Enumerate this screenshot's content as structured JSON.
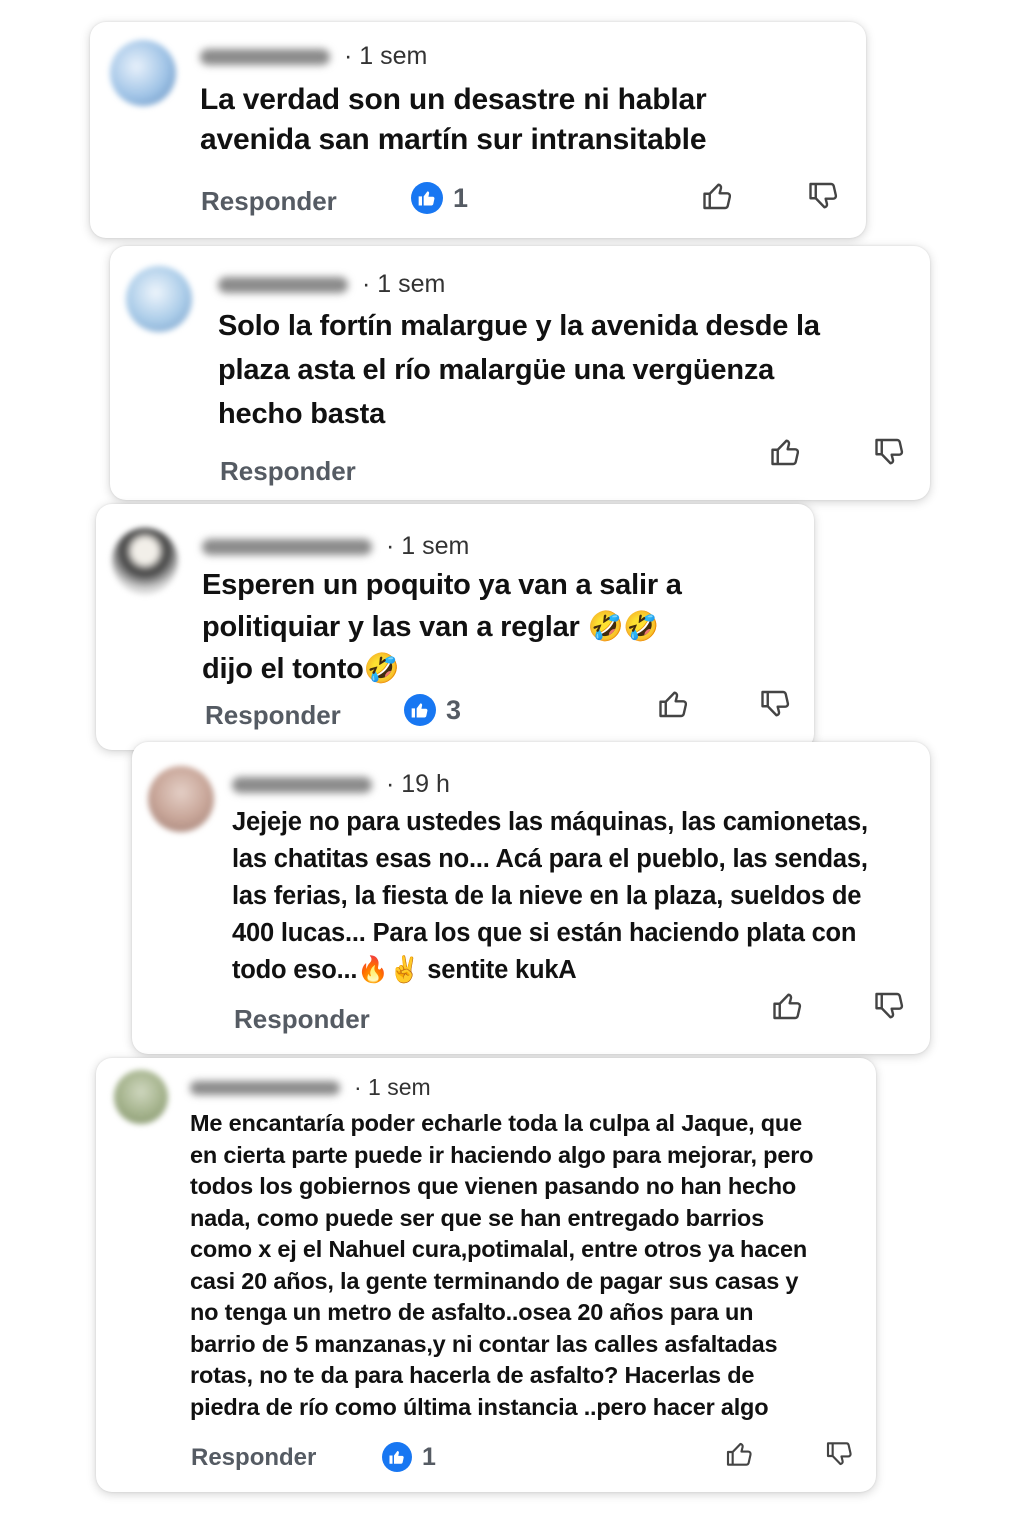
{
  "comments": [
    {
      "time": "· 1 sem",
      "text": "La verdad son un desastre ni hablar\navenida san martín sur intransitable",
      "reply_label": "Responder",
      "like_count": "1",
      "avatar_colors": [
        "#9fc3e6",
        "#e8f1fb",
        "#5a86b8"
      ]
    },
    {
      "time": "· 1 sem",
      "text": "Solo la fortín malargue y la avenida desde la\nplaza asta el río malargüe una vergüenza\nhecho basta",
      "reply_label": "Responder",
      "like_count": "",
      "avatar_colors": [
        "#a9cbe8",
        "#eef5fc",
        "#6d95c2"
      ]
    },
    {
      "time": "· 1 sem",
      "text": "Esperen un poquito ya van a salir a\npolitiquiar y las van a reglar 🤣🤣\ndijo el tonto🤣",
      "reply_label": "Responder",
      "like_count": "3",
      "avatar_colors": [
        "#d9d9d9",
        "#3a3a3a",
        "#f2efe9"
      ]
    },
    {
      "time": "· 19 h",
      "text": "Jejeje no para ustedes las máquinas, las camionetas,\nlas chatitas esas no... Acá para el pueblo, las sendas,\nlas ferias, la fiesta de la nieve en la plaza, sueldos de\n400 lucas... Para los que si están haciendo plata con\ntodo eso...🔥✌️ sentite kukA",
      "reply_label": "Responder",
      "like_count": "",
      "avatar_colors": [
        "#c9a79a",
        "#9c7a70",
        "#e4cfc6"
      ]
    },
    {
      "time": "· 1 sem",
      "text": "Me encantaría poder echarle toda la culpa al Jaque, que\nen cierta parte puede ir haciendo algo para mejorar, pero\ntodos los gobiernos que vienen pasando no han hecho\nnada, como puede ser que se han entregado barrios\ncomo x ej el Nahuel cura,potimalal, entre otros ya hacen\ncasi 20 años, la gente terminando de pagar sus casas y\nno tenga un metro de asfalto..osea 20 años para un\nbarrio de 5 manzanas,y ni contar las calles asfaltadas\nrotas, no te da para hacerla de asfalto? Hacerlas  de\npiedra de río como última instancia ..pero hacer algo",
      "reply_label": "Responder",
      "like_count": "1",
      "avatar_colors": [
        "#a7b58f",
        "#7e8f67",
        "#cfd7bf"
      ]
    }
  ],
  "icons": {
    "like_badge": "thumbs-up-icon",
    "react_up": "thumbs-up-outline-icon",
    "react_down": "thumbs-down-outline-icon"
  },
  "colors": {
    "like_blue": "#1877f2",
    "reply_gray": "#555b63"
  }
}
